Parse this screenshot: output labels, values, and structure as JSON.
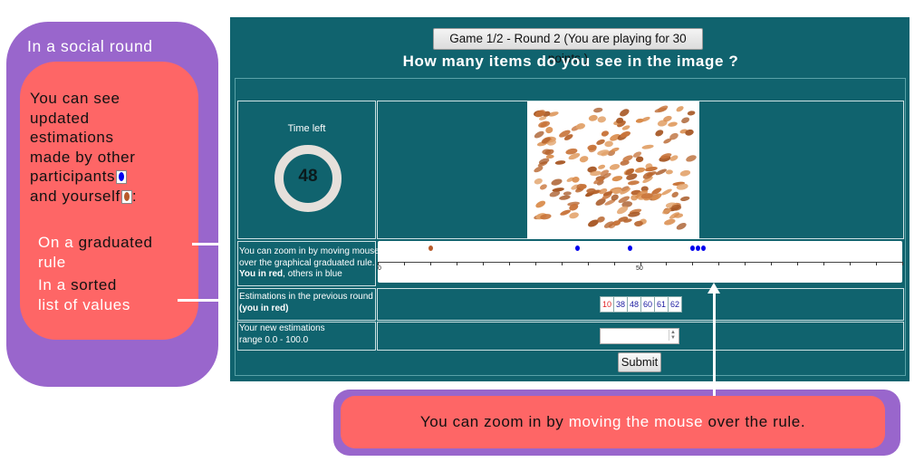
{
  "annotations": {
    "social_title": "In a social round",
    "updated_lines": [
      "You can see",
      "updated",
      "estimations",
      "made by other",
      "participants",
      "and yourself"
    ],
    "yourself_suffix": ":",
    "rule_prefix": "On a ",
    "rule_highlight": "graduated",
    "rule_suffix": "rule",
    "list_prefix": "In a ",
    "list_highlight": "sorted",
    "list_suffix": "list of values",
    "zoom_prefix": "You can zoom in by ",
    "zoom_highlight": "moving the mouse",
    "zoom_suffix": " over the rule."
  },
  "game": {
    "round_label": "Game 1/2 - Round 2 (You are playing for 30 points )",
    "question": "How many items do you see  in the image ?",
    "timer_label": "Time left",
    "timer_value": "48",
    "rule_desc_line1": "You can zoom in by moving mouse",
    "rule_desc_line2": "over the graphical graduated rule.",
    "rule_desc_you": "You in red",
    "rule_desc_others": ", others in blue",
    "rule_tick_0": "0",
    "rule_tick_50": "50",
    "rule_range": [
      0,
      100
    ],
    "rule_points": [
      {
        "value": 10,
        "color": "#b85a2a"
      },
      {
        "value": 38,
        "color": "#0000ee"
      },
      {
        "value": 48,
        "color": "#0000ee"
      },
      {
        "value": 60,
        "color": "#0000ee"
      },
      {
        "value": 61,
        "color": "#0000ee"
      },
      {
        "value": 62,
        "color": "#0000ee"
      }
    ],
    "prev_label_line1": "Estimations in the previous round",
    "prev_label_line2": "(you in red)",
    "prev_estimates": [
      {
        "text": "10",
        "color": "#e02020"
      },
      {
        "text": "38",
        "color": "#1a1aa0"
      },
      {
        "text": "48",
        "color": "#1a1aa0"
      },
      {
        "text": "60",
        "color": "#1a1aa0"
      },
      {
        "text": "61",
        "color": "#1a1aa0"
      },
      {
        "text": "62",
        "color": "#1a1aa0"
      }
    ],
    "new_label_line1": "Your new estimations",
    "new_label_line2": "range 0.0 - 100.0",
    "input_value": "",
    "submit_label": "Submit"
  },
  "colors": {
    "panel": "#10636e",
    "purple": "#9966cc",
    "salmon": "#fe6666",
    "you": "#b85a2a",
    "others": "#0000ee"
  }
}
